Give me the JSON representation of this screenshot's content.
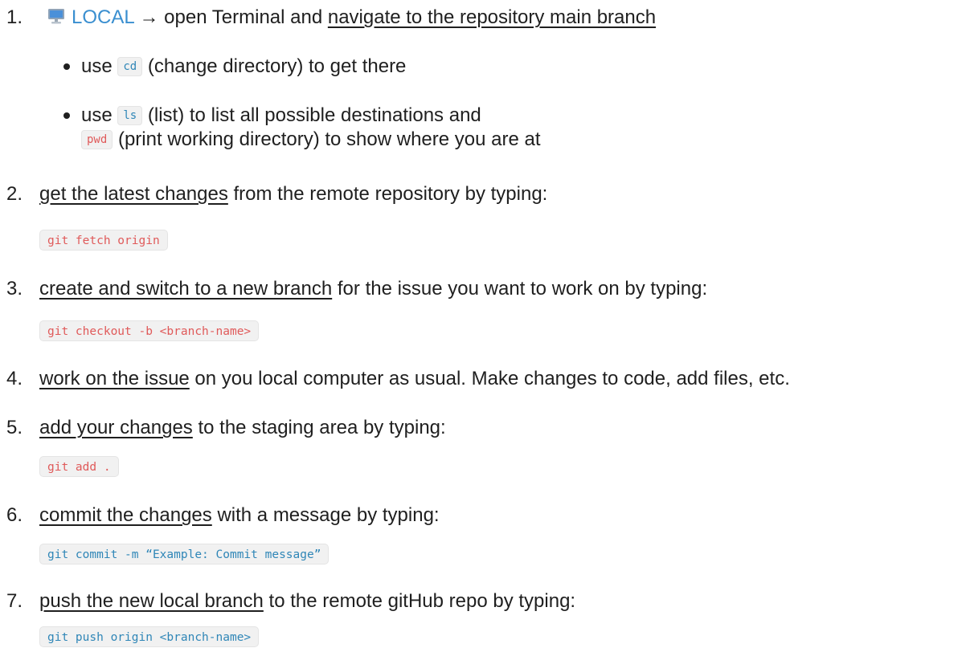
{
  "steps": [
    {
      "num": "1.",
      "local_label": "LOCAL",
      "arrow": "→",
      "text_a": "open Terminal and ",
      "link": "navigate to the repository main branch"
    },
    {
      "num": "2.",
      "link": "get the latest changes",
      "text": " from the remote repository by typing:",
      "code": "git fetch origin"
    },
    {
      "num": "3.",
      "link": "create and switch to a new branch",
      "text": " for the issue you want to work on by typing:",
      "code": "git checkout -b <branch-name>"
    },
    {
      "num": "4.",
      "link": "work on the issue",
      "text": " on you local computer as usual. Make changes to code, add files, etc."
    },
    {
      "num": "5.",
      "link": "add your changes",
      "text": " to the staging area by typing:",
      "code": "git add ."
    },
    {
      "num": "6.",
      "link": "commit the changes",
      "text": " with a message by typing:",
      "code": "git commit -m “Example: Commit message”"
    },
    {
      "num": "7.",
      "link": "push the new local branch",
      "text": " to the remote gitHub repo by typing:",
      "code": "git push origin <branch-name>"
    }
  ],
  "subitems": [
    {
      "pre": "use ",
      "code": "cd",
      "post": " (change directory) to get there"
    },
    {
      "pre": "use ",
      "code": "ls",
      "post": " (list) to list all possible destinations and"
    },
    {
      "code": "pwd",
      "post": " (print working directory) to show where you are at"
    }
  ],
  "icons": {
    "local": "desktop-computer-icon"
  },
  "colors": {
    "link": "#3a8fd0",
    "code_red": "#e05a5a",
    "code_teal": "#2f86b7",
    "code_bg": "#f1f1f1"
  }
}
